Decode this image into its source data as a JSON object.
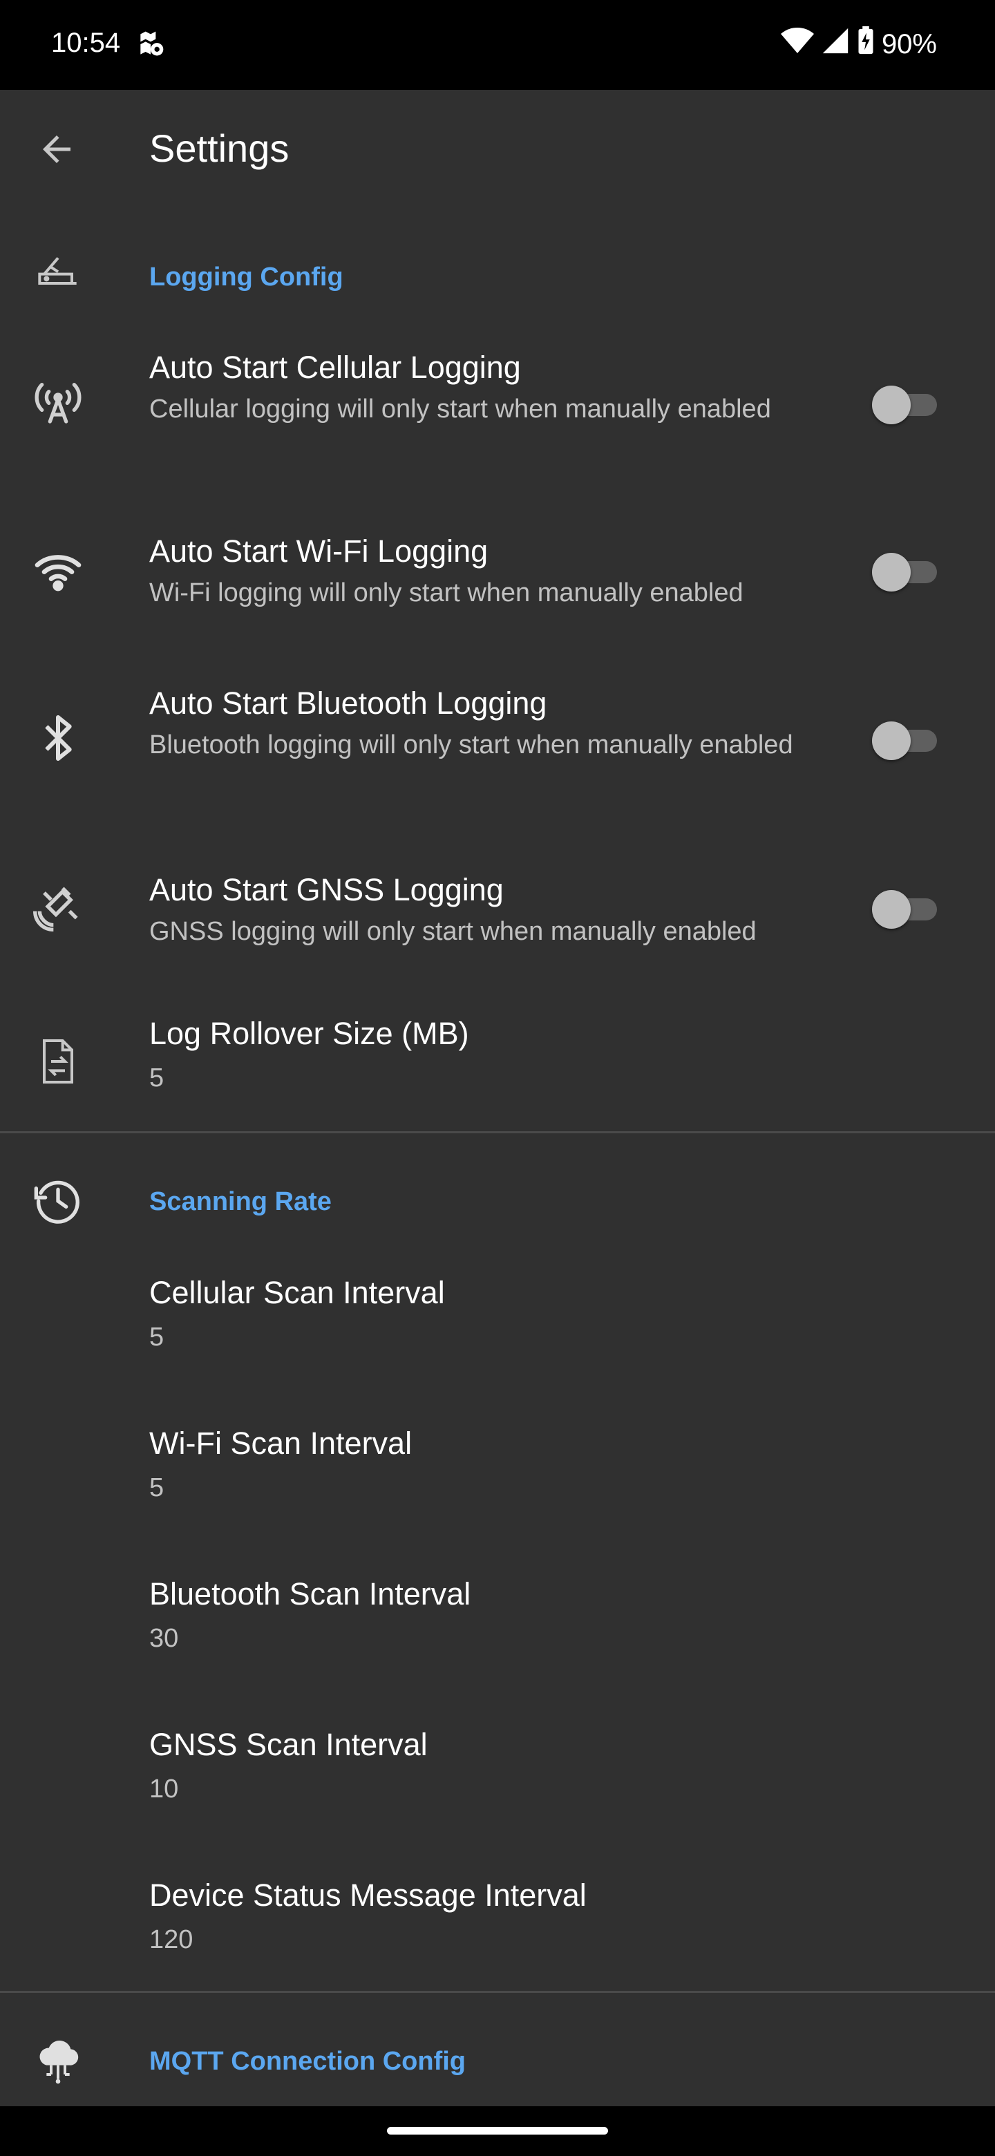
{
  "status_bar": {
    "time": "10:54",
    "battery": "90%",
    "icons": [
      "location-icon",
      "wifi-icon",
      "signal-icon",
      "battery-charging-icon"
    ]
  },
  "app_bar": {
    "title": "Settings",
    "back_icon": "arrow-back-icon"
  },
  "logging": {
    "category": "Logging Config",
    "items": [
      {
        "title": "Auto Start Cellular Logging",
        "summary": "Cellular logging will only start when manually enabled",
        "checked": false
      },
      {
        "title": "Auto Start Wi-Fi Logging",
        "summary": "Wi-Fi logging will only start when manually enabled",
        "checked": false
      },
      {
        "title": "Auto Start Bluetooth Logging",
        "summary": "Bluetooth logging will only start when manually enabled",
        "checked": false
      },
      {
        "title": "Auto Start GNSS Logging",
        "summary": "GNSS logging will only start when manually enabled",
        "checked": false
      }
    ],
    "rollover": {
      "title": "Log Rollover Size (MB)",
      "value": "5"
    }
  },
  "scanning": {
    "category": "Scanning Rate",
    "items": [
      {
        "title": "Cellular Scan Interval",
        "value": "5"
      },
      {
        "title": "Wi-Fi Scan Interval",
        "value": "5"
      },
      {
        "title": "Bluetooth Scan Interval",
        "value": "30"
      },
      {
        "title": "GNSS Scan Interval",
        "value": "10"
      },
      {
        "title": "Device Status Message Interval",
        "value": "120"
      }
    ]
  },
  "mqtt": {
    "category": "MQTT Connection Config"
  },
  "colors": {
    "background": "#303030",
    "accent": "#5ba7f0",
    "status_bar": "#000000"
  }
}
